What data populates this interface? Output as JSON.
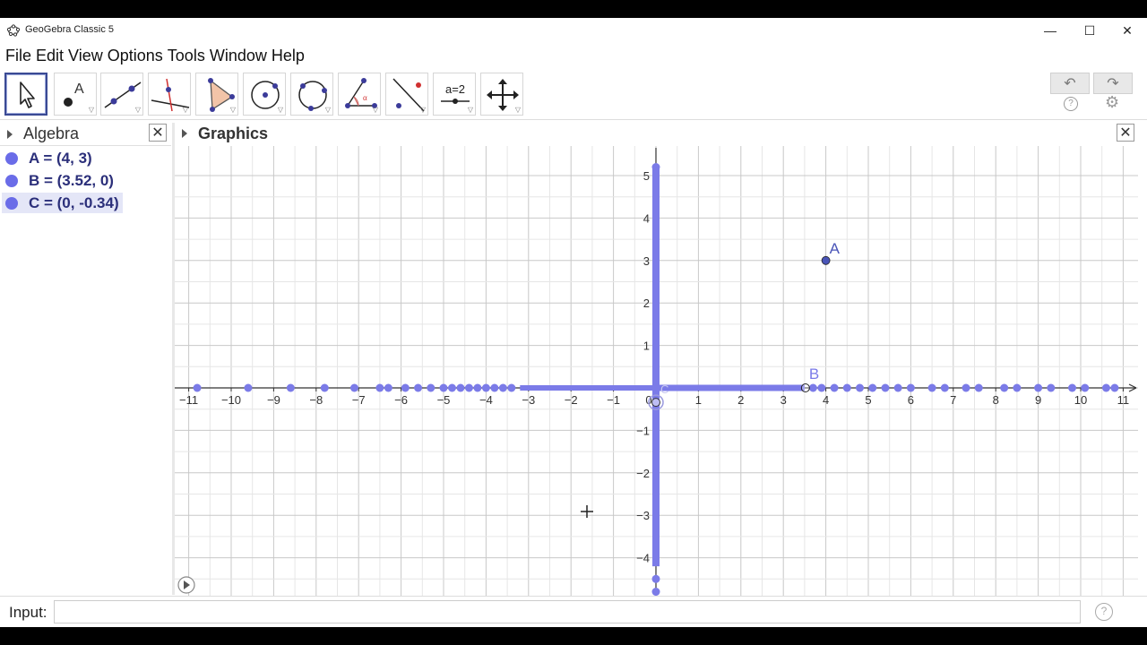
{
  "window": {
    "title": "GeoGebra Classic 5",
    "minimize": "—",
    "maximize": "☐",
    "close": "✕"
  },
  "menu": [
    "File",
    "Edit",
    "View",
    "Options",
    "Tools",
    "Window",
    "Help"
  ],
  "toolbar": {
    "tools": [
      {
        "name": "move",
        "icon": "move-arrow-icon"
      },
      {
        "name": "point",
        "icon": "point-icon"
      },
      {
        "name": "line",
        "icon": "line-icon"
      },
      {
        "name": "perpendicular",
        "icon": "perpendicular-line-icon"
      },
      {
        "name": "polygon",
        "icon": "polygon-icon"
      },
      {
        "name": "circle-center",
        "icon": "circle-center-icon"
      },
      {
        "name": "conic",
        "icon": "circle-three-points-icon"
      },
      {
        "name": "angle",
        "icon": "angle-icon"
      },
      {
        "name": "reflect",
        "icon": "reflect-icon"
      },
      {
        "name": "slider",
        "icon": "slider-icon",
        "label": "a=2"
      },
      {
        "name": "move-graphics",
        "icon": "move-graphics-icon"
      }
    ],
    "undo": "↶",
    "redo": "↷",
    "help": "?",
    "settings": "⚙"
  },
  "algebra": {
    "title": "Algebra",
    "close": "✕",
    "items": [
      {
        "text": "A = (4, 3)",
        "selected": false
      },
      {
        "text": "B = (3.52, 0)",
        "selected": false
      },
      {
        "text": "C = (0, -0.34)",
        "selected": true
      }
    ]
  },
  "graphics": {
    "title": "Graphics",
    "close": "✕",
    "x_range": [
      -11.3,
      11.4
    ],
    "y_range": [
      -5.3,
      5.3
    ],
    "x_ticks": [
      -11,
      -10,
      -9,
      -8,
      -7,
      -6,
      -5,
      -4,
      -3,
      -2,
      -1,
      0,
      1,
      2,
      3,
      4,
      5,
      6,
      7,
      8,
      9,
      10,
      11
    ],
    "y_ticks": [
      -5,
      -4,
      -3,
      -2,
      -1,
      1,
      2,
      3,
      4,
      5
    ],
    "points": [
      {
        "label": "A",
        "x": 4,
        "y": 3
      },
      {
        "label": "B",
        "x": 3.52,
        "y": 0
      },
      {
        "label": "C",
        "x": 0,
        "y": -0.34
      }
    ],
    "trace_color": "#7b7be8",
    "point_color": "#4a55b8"
  },
  "input": {
    "label": "Input:",
    "placeholder": "",
    "help": "?"
  }
}
